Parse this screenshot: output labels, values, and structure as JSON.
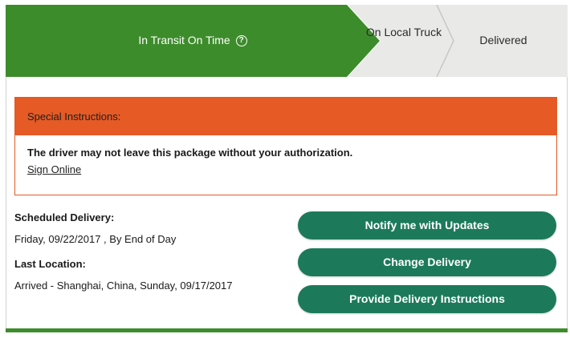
{
  "progress": {
    "current_step": "In Transit On Time",
    "step_2": "On Local Truck",
    "step_3": "Delivered",
    "colors": {
      "current": "#3d8c2b",
      "pending": "#e9eae7"
    }
  },
  "special_instructions": {
    "header": "Special Instructions:",
    "message": "The driver may not leave this package without your authorization.",
    "link_label": "Sign Online",
    "color": "#e55a25"
  },
  "delivery": {
    "scheduled_label": "Scheduled Delivery:",
    "scheduled_value": "Friday, 09/22/2017 , By End of Day",
    "last_location_label": "Last Location:",
    "last_location_value": "Arrived - Shanghai, China, Sunday, 09/17/2017"
  },
  "actions": {
    "notify_label": "Notify me with Updates",
    "change_label": "Change Delivery",
    "instructions_label": "Provide Delivery Instructions",
    "button_color": "#1c7a5b"
  }
}
